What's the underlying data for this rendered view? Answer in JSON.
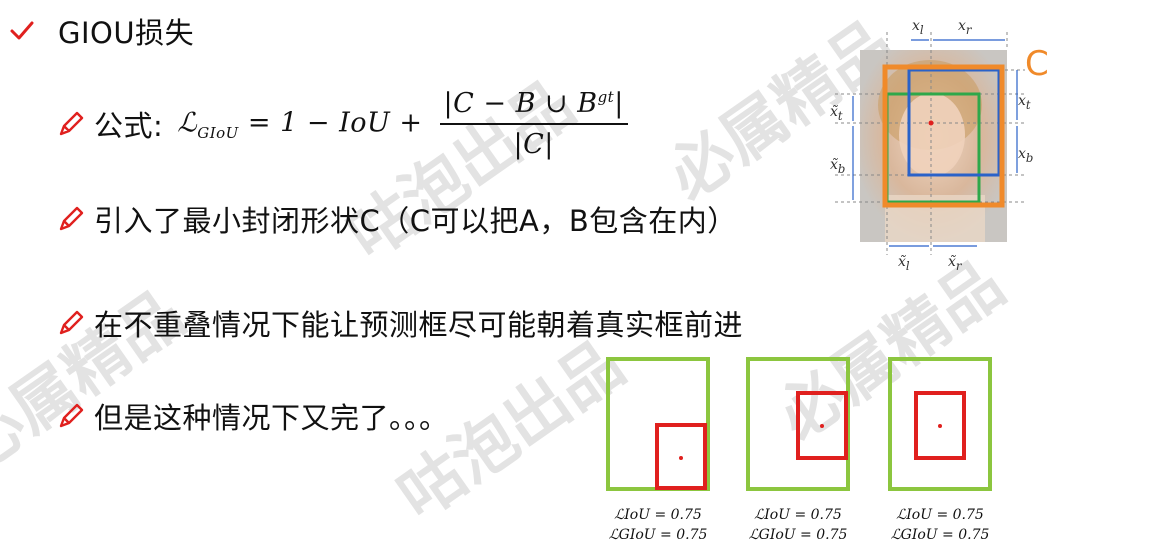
{
  "title": "GIOU损失",
  "bullets": {
    "formula_label": "公式:",
    "formula": {
      "lhs": "ℒ",
      "lhs_sub": "GIoU",
      "rhs_prefix": " = 1 − IoU + ",
      "numerator": "|C − B ∪ B",
      "numerator_sup": "gt",
      "numerator_end": "|",
      "denominator": "|C|"
    },
    "b2": "引入了最小封闭形状C（C可以把A，B包含在内）",
    "b3": "在不重叠情况下能让预测框尽可能朝着真实框前进",
    "b4": "但是这种情况下又完了。。。"
  },
  "photo_labels": {
    "c": "C",
    "xl": "x",
    "xl_sub": "l",
    "xr": "x",
    "xr_sub": "r",
    "xt": "x",
    "xt_sub": "t",
    "xb": "x",
    "xb_sub": "b",
    "txt": "x̃",
    "txt_sub": "t",
    "txb": "x̃",
    "txb_sub": "b",
    "txl": "x̃",
    "txl_sub": "l",
    "txr": "x̃",
    "txr_sub": "r"
  },
  "cases": [
    {
      "iou": "ℒIoU = 0.75",
      "giou": "ℒGIoU = 0.75"
    },
    {
      "iou": "ℒIoU = 0.75",
      "giou": "ℒGIoU = 0.75"
    },
    {
      "iou": "ℒIoU = 0.75",
      "giou": "ℒGIoU = 0.75"
    }
  ],
  "watermark": [
    "咕泡出品",
    "必属精品"
  ],
  "colors": {
    "orange": "#f08a2a",
    "green": "#8cc63f",
    "red": "#e0201e",
    "blue": "#2a62c9",
    "pen": "#e0201e"
  }
}
